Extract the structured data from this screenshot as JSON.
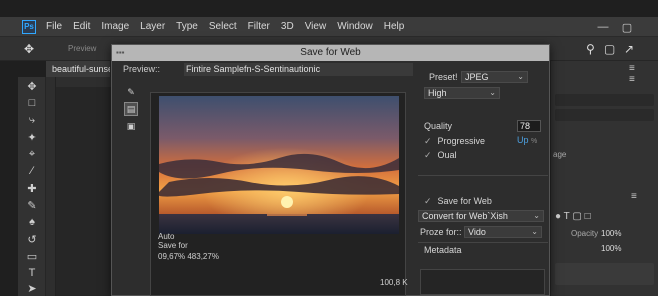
{
  "menubar": {
    "logo": "Ps",
    "items": [
      "File",
      "Edit",
      "Image",
      "Layer",
      "Type",
      "Select",
      "Filter",
      "3D",
      "View",
      "Window",
      "Help"
    ]
  },
  "options": {
    "preview_label": "Preview"
  },
  "tab": {
    "title": "beautiful-sunset"
  },
  "dialog": {
    "title": "Save for Web",
    "preview_label": "Preview::",
    "preview_name": "Fintire Samplefn-S-Sentinautionic",
    "info_line1": "Auto",
    "info_line2": "Save for",
    "info_line3": "09,67%  483,27%",
    "size": "100,8 K",
    "preset_label": "Preset!",
    "preset_value": "JPEG",
    "quality_preset": "High",
    "quality_label": "Quality",
    "quality_value": "78",
    "up_label": "Up",
    "up_unit": "%",
    "progressive_label": "Progressive",
    "oual_label": "Oual",
    "save_for_web_label": "Save for Web",
    "convert_label": "Convert for Web`Xish",
    "proze_label": "Proze for::",
    "proze_value": "Vido",
    "metadata_label": "Metadata"
  },
  "panels": {
    "age_text": "age",
    "opacity_label": "Opacity",
    "opacity_value": "100%",
    "fill_value": "100%"
  },
  "colors": {
    "accent": "#31a8ff",
    "dialog_bg": "#2d2d2d",
    "titlebar": "#b6b6b6"
  }
}
